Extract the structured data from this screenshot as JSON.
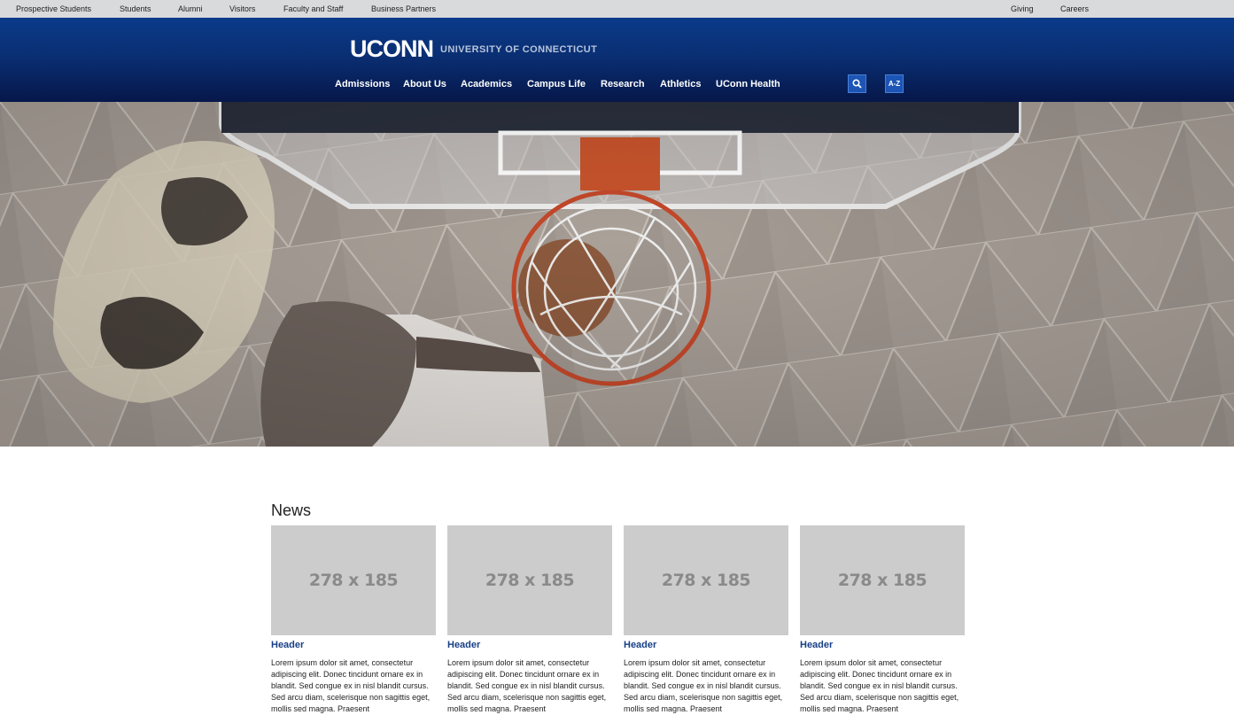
{
  "utility_nav": {
    "left": [
      "Prospective Students",
      "Students",
      "Alumni",
      "Visitors",
      "Faculty and Staff",
      "Business Partners"
    ],
    "right": [
      "Giving",
      "Careers"
    ]
  },
  "header": {
    "logo_word": "UCONN",
    "logo_sub": "UNIVERSITY OF CONNECTICUT",
    "nav": [
      "Admissions",
      "About Us",
      "Academics",
      "Campus Life",
      "Research",
      "Athletics",
      "UConn Health"
    ],
    "search_icon": "search-icon",
    "az_label": "A-Z"
  },
  "hero": {
    "image": "basketball-dunk-photo"
  },
  "news": {
    "title": "News",
    "cards": [
      {
        "placeholder": "278 x 185",
        "header": "Header",
        "body": "Lorem ipsum dolor sit amet, consectetur adipiscing elit. Donec tincidunt ornare ex in blandit. Sed congue ex in nisl blandit cursus. Sed arcu diam, scelerisque non sagittis eget, mollis sed magna. Praesent"
      },
      {
        "placeholder": "278 x 185",
        "header": "Header",
        "body": "Lorem ipsum dolor sit amet, consectetur adipiscing elit. Donec tincidunt ornare ex in blandit. Sed congue ex in nisl blandit cursus. Sed arcu diam, scelerisque non sagittis eget, mollis sed magna. Praesent"
      },
      {
        "placeholder": "278 x 185",
        "header": "Header",
        "body": "Lorem ipsum dolor sit amet, consectetur adipiscing elit. Donec tincidunt ornare ex in blandit. Sed congue ex in nisl blandit cursus. Sed arcu diam, scelerisque non sagittis eget, mollis sed magna. Praesent"
      },
      {
        "placeholder": "278 x 185",
        "header": "Header",
        "body": "Lorem ipsum dolor sit amet, consectetur adipiscing elit. Donec tincidunt ornare ex in blandit. Sed congue ex in nisl blandit cursus. Sed arcu diam, scelerisque non sagittis eget, mollis sed magna. Praesent"
      }
    ]
  },
  "colors": {
    "header_dark": "#06174a",
    "header_blue": "#0a3a8a",
    "link_blue": "#173f86",
    "placeholder_gray": "#cccccc"
  }
}
